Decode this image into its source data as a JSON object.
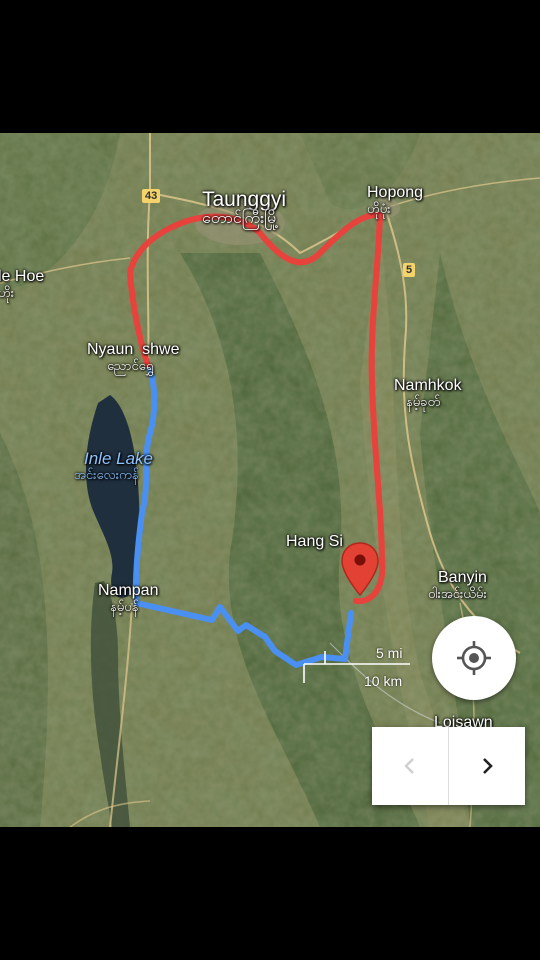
{
  "map": {
    "places": [
      {
        "id": "taunggyi",
        "name": "Taunggyi",
        "native": "တောင်ကြီးမြို့"
      },
      {
        "id": "hopong",
        "name": "Hopong",
        "native": "ဟိုပုံး"
      },
      {
        "id": "ywa-hoe",
        "name": "le Hoe",
        "native": "ဟိုး"
      },
      {
        "id": "nyaungshwe",
        "name": "Nyaun  shwe",
        "native": "ညောင်ရွှေ"
      },
      {
        "id": "namhkok",
        "name": "Namhkok",
        "native": "နမ့်ခုတ်"
      },
      {
        "id": "inle",
        "name": "Inle Lake",
        "native": "အင်းလေးကန်"
      },
      {
        "id": "hangsi",
        "name": "Hang Si",
        "native": ""
      },
      {
        "id": "banyin",
        "name": "Banyin",
        "native": "ဝါးအင်းယိမ်း"
      },
      {
        "id": "nampan",
        "name": "Nampan",
        "native": "နမ့်ပန်"
      },
      {
        "id": "loilem",
        "name": "Loisawn",
        "native": ""
      }
    ],
    "road_shields": {
      "r43": "43",
      "r5": "5"
    },
    "scale": {
      "miles": "5 mi",
      "km": "10 km"
    },
    "routes": [
      {
        "id": "blue-route",
        "color": "#4a90f2"
      },
      {
        "id": "red-route",
        "color": "#e8423c"
      }
    ],
    "pin_color": "#e34133",
    "controls": {
      "locate_icon": "my-location-icon",
      "prev_icon": "chevron-left-icon",
      "next_icon": "chevron-right-icon"
    }
  }
}
